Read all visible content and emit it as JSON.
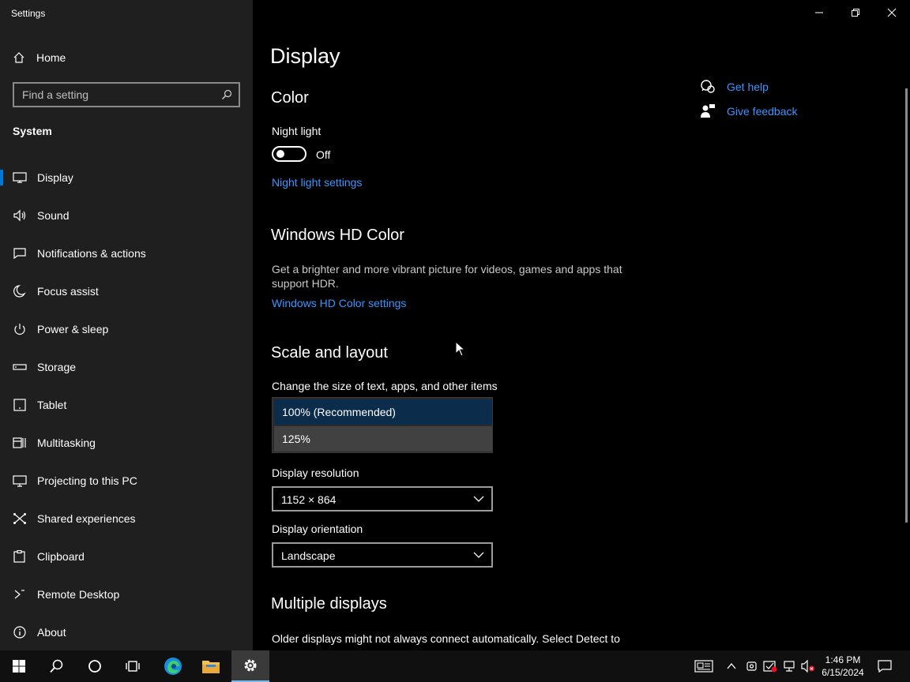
{
  "window": {
    "title": "Settings"
  },
  "sidebar": {
    "home_label": "Home",
    "search_placeholder": "Find a setting",
    "section_label": "System",
    "items": [
      {
        "label": "Display",
        "icon": "monitor-icon",
        "active": true
      },
      {
        "label": "Sound",
        "icon": "speaker-icon"
      },
      {
        "label": "Notifications & actions",
        "icon": "notification-icon"
      },
      {
        "label": "Focus assist",
        "icon": "moon-icon"
      },
      {
        "label": "Power & sleep",
        "icon": "power-icon"
      },
      {
        "label": "Storage",
        "icon": "storage-icon"
      },
      {
        "label": "Tablet",
        "icon": "tablet-icon"
      },
      {
        "label": "Multitasking",
        "icon": "multitasking-icon"
      },
      {
        "label": "Projecting to this PC",
        "icon": "projecting-icon"
      },
      {
        "label": "Shared experiences",
        "icon": "shared-experiences-icon"
      },
      {
        "label": "Clipboard",
        "icon": "clipboard-icon"
      },
      {
        "label": "Remote Desktop",
        "icon": "remote-desktop-icon"
      },
      {
        "label": "About",
        "icon": "info-icon"
      }
    ]
  },
  "main": {
    "page_title": "Display",
    "color": {
      "heading": "Color",
      "night_light_label": "Night light",
      "night_light_state": "Off",
      "night_light_settings_link": "Night light settings"
    },
    "hdr": {
      "heading": "Windows HD Color",
      "description": "Get a brighter and more vibrant picture for videos, games and apps that support HDR.",
      "settings_link": "Windows HD Color settings"
    },
    "scale": {
      "heading": "Scale and layout",
      "size_label": "Change the size of text, apps, and other items",
      "options": [
        "100% (Recommended)",
        "125%"
      ],
      "resolution_label": "Display resolution",
      "resolution_value": "1152 × 864",
      "orientation_label": "Display orientation",
      "orientation_value": "Landscape"
    },
    "multiple": {
      "heading": "Multiple displays",
      "description": "Older displays might not always connect automatically. Select Detect to"
    }
  },
  "related": {
    "get_help": "Get help",
    "give_feedback": "Give feedback"
  },
  "taskbar": {
    "time": "1:46 PM",
    "date": "6/15/2024"
  },
  "colors": {
    "accent": "#0078d7",
    "link": "#3a96ff",
    "sidebar_bg": "#1f1f1f",
    "background": "#000000"
  }
}
